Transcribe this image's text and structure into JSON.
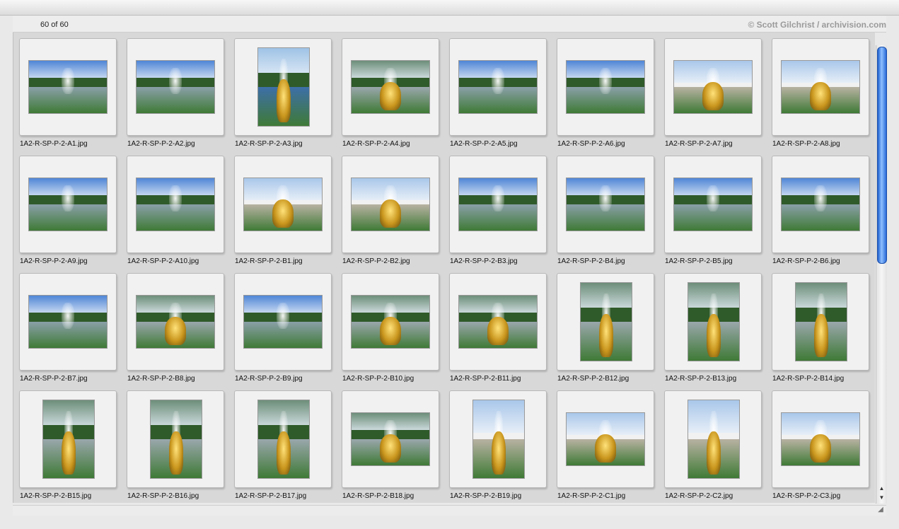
{
  "header": {
    "count": "60 of 60",
    "credit": "© Scott Gilchrist / archivision.com"
  },
  "icons": {
    "scroll_up": "▲",
    "scroll_down": "▼",
    "resize_grip": "◢"
  },
  "scrollbar": {
    "position_fraction": 0.0,
    "visible_fraction": 0.5
  },
  "colors": {
    "thumb_blue": "#2a6ad8",
    "card_bg": "#f1f1f1",
    "pane_bg": "#d8d8d8"
  },
  "items": [
    {
      "name": "1A2-R-SP-P-2-A1.jpg",
      "orientation": "landscape",
      "scene": "fountain"
    },
    {
      "name": "1A2-R-SP-P-2-A2.jpg",
      "orientation": "landscape",
      "scene": "fountain"
    },
    {
      "name": "1A2-R-SP-P-2-A3.jpg",
      "orientation": "portrait",
      "scene": "canal"
    },
    {
      "name": "1A2-R-SP-P-2-A4.jpg",
      "orientation": "landscape",
      "scene": "gold"
    },
    {
      "name": "1A2-R-SP-P-2-A5.jpg",
      "orientation": "landscape",
      "scene": "fountain"
    },
    {
      "name": "1A2-R-SP-P-2-A6.jpg",
      "orientation": "landscape",
      "scene": "fountain"
    },
    {
      "name": "1A2-R-SP-P-2-A7.jpg",
      "orientation": "landscape",
      "scene": "palace"
    },
    {
      "name": "1A2-R-SP-P-2-A8.jpg",
      "orientation": "landscape",
      "scene": "palace"
    },
    {
      "name": "1A2-R-SP-P-2-A9.jpg",
      "orientation": "landscape",
      "scene": "fountain"
    },
    {
      "name": "1A2-R-SP-P-2-A10.jpg",
      "orientation": "landscape",
      "scene": "fountain"
    },
    {
      "name": "1A2-R-SP-P-2-B1.jpg",
      "orientation": "landscape",
      "scene": "palace"
    },
    {
      "name": "1A2-R-SP-P-2-B2.jpg",
      "orientation": "landscape",
      "scene": "palace"
    },
    {
      "name": "1A2-R-SP-P-2-B3.jpg",
      "orientation": "landscape",
      "scene": "fountain"
    },
    {
      "name": "1A2-R-SP-P-2-B4.jpg",
      "orientation": "landscape",
      "scene": "fountain"
    },
    {
      "name": "1A2-R-SP-P-2-B5.jpg",
      "orientation": "landscape",
      "scene": "fountain"
    },
    {
      "name": "1A2-R-SP-P-2-B6.jpg",
      "orientation": "landscape",
      "scene": "fountain"
    },
    {
      "name": "1A2-R-SP-P-2-B7.jpg",
      "orientation": "landscape",
      "scene": "fountain"
    },
    {
      "name": "1A2-R-SP-P-2-B8.jpg",
      "orientation": "landscape",
      "scene": "gold"
    },
    {
      "name": "1A2-R-SP-P-2-B9.jpg",
      "orientation": "landscape",
      "scene": "fountain"
    },
    {
      "name": "1A2-R-SP-P-2-B10.jpg",
      "orientation": "landscape",
      "scene": "gold"
    },
    {
      "name": "1A2-R-SP-P-2-B11.jpg",
      "orientation": "landscape",
      "scene": "gold"
    },
    {
      "name": "1A2-R-SP-P-2-B12.jpg",
      "orientation": "portrait",
      "scene": "gold"
    },
    {
      "name": "1A2-R-SP-P-2-B13.jpg",
      "orientation": "portrait",
      "scene": "gold"
    },
    {
      "name": "1A2-R-SP-P-2-B14.jpg",
      "orientation": "portrait",
      "scene": "gold"
    },
    {
      "name": "1A2-R-SP-P-2-B15.jpg",
      "orientation": "portrait",
      "scene": "gold"
    },
    {
      "name": "1A2-R-SP-P-2-B16.jpg",
      "orientation": "portrait",
      "scene": "gold"
    },
    {
      "name": "1A2-R-SP-P-2-B17.jpg",
      "orientation": "portrait",
      "scene": "gold"
    },
    {
      "name": "1A2-R-SP-P-2-B18.jpg",
      "orientation": "landscape",
      "scene": "gold"
    },
    {
      "name": "1A2-R-SP-P-2-B19.jpg",
      "orientation": "portrait",
      "scene": "palace"
    },
    {
      "name": "1A2-R-SP-P-2-C1.jpg",
      "orientation": "landscape",
      "scene": "palace"
    },
    {
      "name": "1A2-R-SP-P-2-C2.jpg",
      "orientation": "portrait",
      "scene": "palace"
    },
    {
      "name": "1A2-R-SP-P-2-C3.jpg",
      "orientation": "landscape",
      "scene": "palace"
    }
  ]
}
